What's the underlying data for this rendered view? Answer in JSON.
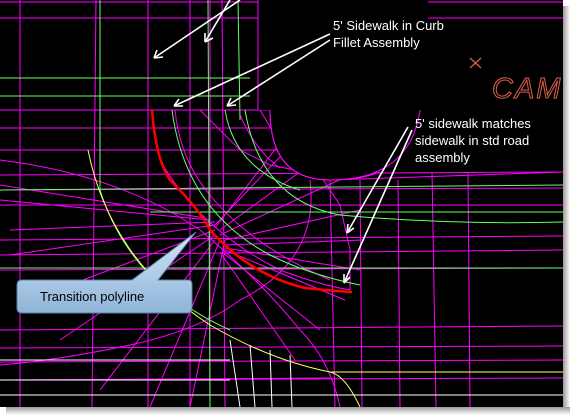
{
  "annotations": {
    "curb_fillet_line1": "5' Sidewalk in Curb",
    "curb_fillet_line2": "Fillet Assembly",
    "std_road_line1": "5' sidewalk matches",
    "std_road_line2": "sidewalk in std road",
    "std_road_line3": "assembly",
    "callout": "Transition polyline",
    "cam_text": "CAM"
  },
  "colors": {
    "background": "#000000",
    "magenta_lines": "#ff00ff",
    "green_lines": "#66ff66",
    "yellow_lines": "#ffff66",
    "white_lines": "#ffffff",
    "transition_polyline": "#ff0000",
    "callout_fill": "#a8c8e8",
    "cam_text": "#e0604a"
  },
  "icons": [
    "arrow-icon",
    "x-marker-icon"
  ]
}
